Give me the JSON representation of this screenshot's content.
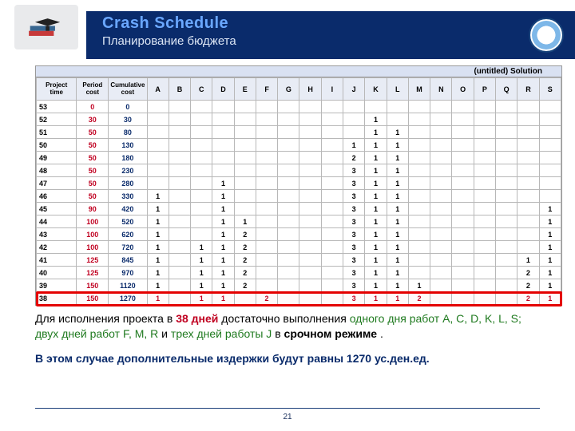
{
  "header": {
    "title": "Crash Schedule",
    "subtitle": "Планирование бюджета"
  },
  "chart_data": {
    "type": "table",
    "title": "(untitled) Solution",
    "columns": [
      "Project time",
      "Period cost",
      "Cumulative cost",
      "A",
      "B",
      "C",
      "D",
      "E",
      "F",
      "G",
      "H",
      "I",
      "J",
      "K",
      "L",
      "M",
      "N",
      "O",
      "P",
      "Q",
      "R",
      "S"
    ],
    "highlight_row_project_time": 38,
    "rows": [
      {
        "pt": "53",
        "pc": "0",
        "cc": "0",
        "x": {}
      },
      {
        "pt": "52",
        "pc": "30",
        "cc": "30",
        "x": {
          "K": "1"
        }
      },
      {
        "pt": "51",
        "pc": "50",
        "cc": "80",
        "x": {
          "K": "1",
          "L": "1"
        }
      },
      {
        "pt": "50",
        "pc": "50",
        "cc": "130",
        "x": {
          "J": "1",
          "K": "1",
          "L": "1"
        }
      },
      {
        "pt": "49",
        "pc": "50",
        "cc": "180",
        "x": {
          "J": "2",
          "K": "1",
          "L": "1"
        }
      },
      {
        "pt": "48",
        "pc": "50",
        "cc": "230",
        "x": {
          "J": "3",
          "K": "1",
          "L": "1"
        }
      },
      {
        "pt": "47",
        "pc": "50",
        "cc": "280",
        "x": {
          "D": "1",
          "J": "3",
          "K": "1",
          "L": "1"
        }
      },
      {
        "pt": "46",
        "pc": "50",
        "cc": "330",
        "x": {
          "A": "1",
          "D": "1",
          "J": "3",
          "K": "1",
          "L": "1"
        }
      },
      {
        "pt": "45",
        "pc": "90",
        "cc": "420",
        "x": {
          "A": "1",
          "D": "1",
          "J": "3",
          "K": "1",
          "L": "1",
          "S": "1"
        }
      },
      {
        "pt": "44",
        "pc": "100",
        "cc": "520",
        "x": {
          "A": "1",
          "D": "1",
          "E": "1",
          "J": "3",
          "K": "1",
          "L": "1",
          "S": "1"
        }
      },
      {
        "pt": "43",
        "pc": "100",
        "cc": "620",
        "x": {
          "A": "1",
          "D": "1",
          "E": "2",
          "J": "3",
          "K": "1",
          "L": "1",
          "S": "1"
        }
      },
      {
        "pt": "42",
        "pc": "100",
        "cc": "720",
        "x": {
          "A": "1",
          "C": "1",
          "D": "1",
          "E": "2",
          "J": "3",
          "K": "1",
          "L": "1",
          "S": "1"
        }
      },
      {
        "pt": "41",
        "pc": "125",
        "cc": "845",
        "x": {
          "A": "1",
          "C": "1",
          "D": "1",
          "E": "2",
          "J": "3",
          "K": "1",
          "L": "1",
          "R": "1",
          "S": "1"
        }
      },
      {
        "pt": "40",
        "pc": "125",
        "cc": "970",
        "x": {
          "A": "1",
          "C": "1",
          "D": "1",
          "E": "2",
          "J": "3",
          "K": "1",
          "L": "1",
          "R": "2",
          "S": "1"
        }
      },
      {
        "pt": "39",
        "pc": "150",
        "cc": "1120",
        "x": {
          "A": "1",
          "C": "1",
          "D": "1",
          "E": "2",
          "J": "3",
          "K": "1",
          "L": "1",
          "M": "1",
          "R": "2",
          "S": "1"
        }
      },
      {
        "pt": "38",
        "pc": "150",
        "cc": "1270",
        "x": {
          "A": "1",
          "C": "1",
          "D": "1",
          "F": "2",
          "J": "3",
          "K": "1",
          "L": "1",
          "M": "2",
          "R": "2",
          "S": "1"
        }
      }
    ]
  },
  "narrative": {
    "p1_a": "Для исполнения проекта в ",
    "p1_days": "38 дней",
    "p1_b": " достаточно выполнения ",
    "p1_g1": "одного дня работ A, C, D, K, L, S; двух дней работ F, M, R",
    "p1_c": " и ",
    "p1_g2": "трех дней работы J",
    "p1_d": " в ",
    "p1_e": "срочном режиме",
    "p1_f": " .",
    "p2": "В этом случае дополнительные издержки будут равны 1270 ус.ден.ед."
  },
  "page": "21"
}
